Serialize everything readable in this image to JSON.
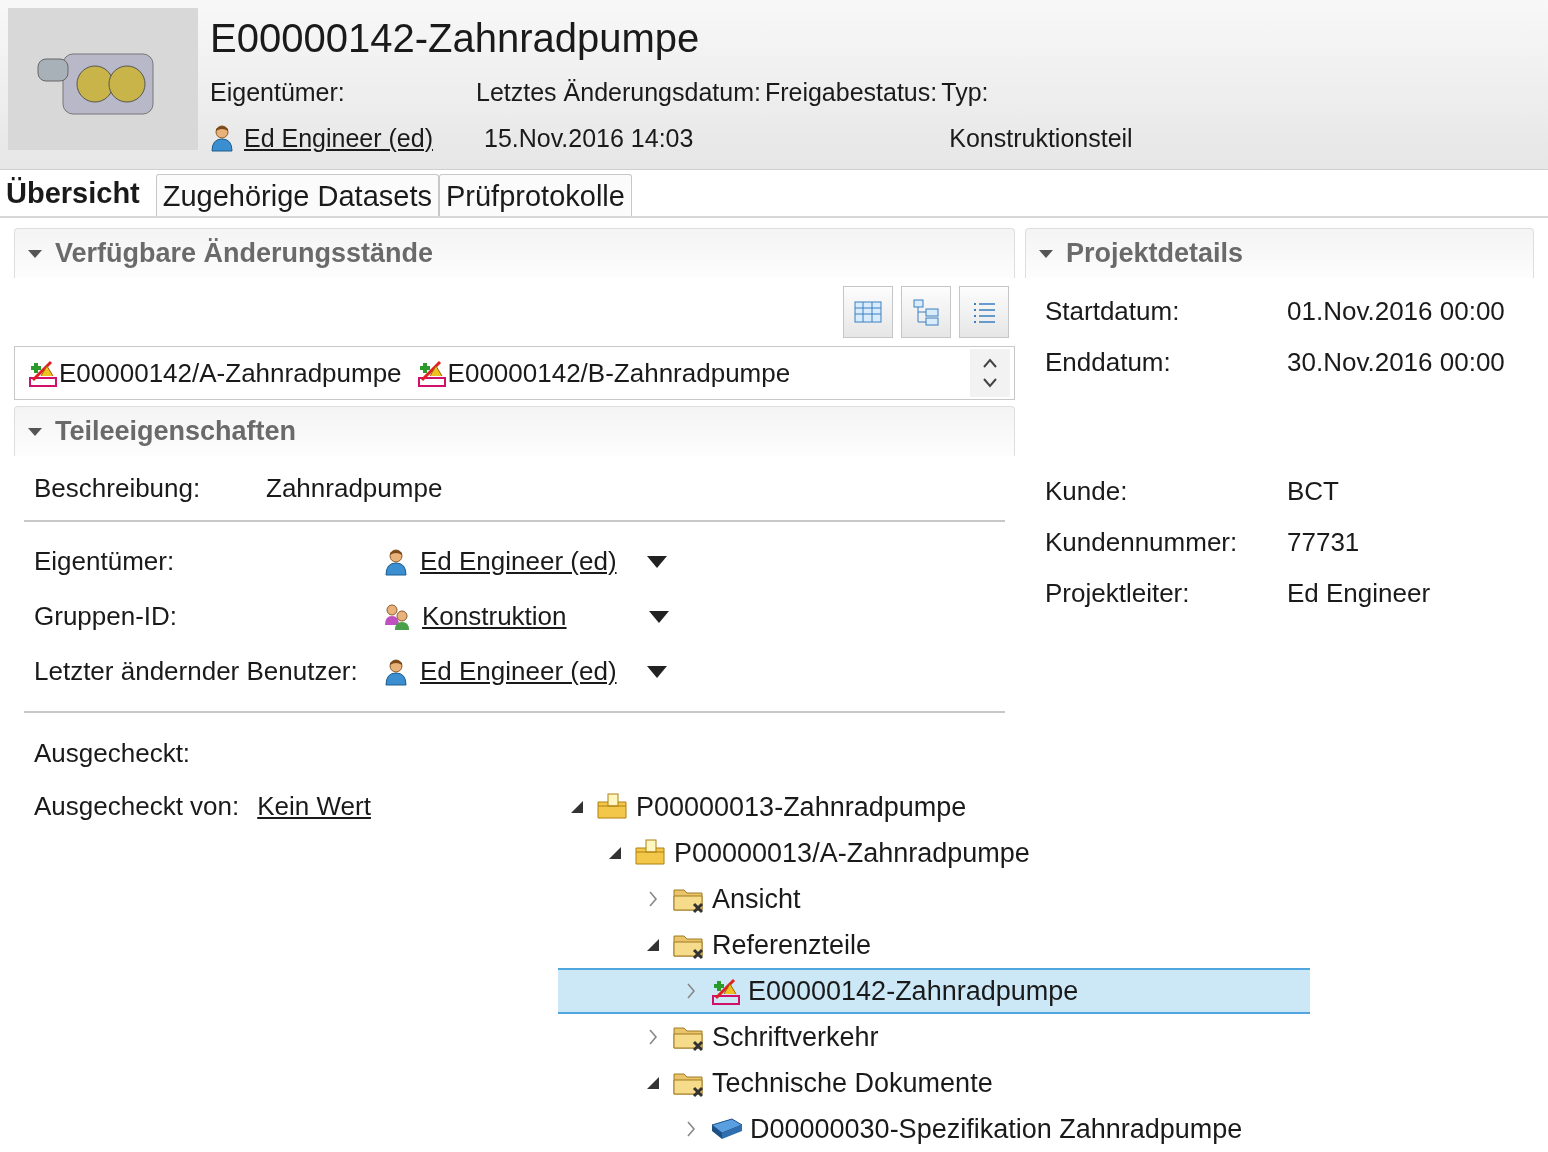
{
  "header": {
    "title": "E00000142-Zahnradpumpe",
    "fields": [
      {
        "label": "Eigentümer:",
        "value": "Ed Engineer (ed)",
        "kind": "user-link"
      },
      {
        "label": "Letztes Änderungsdatum:",
        "value": "15.Nov.2016 14:03",
        "kind": "text"
      },
      {
        "label": "Freigabestatus:"
      },
      {
        "label": "Typ:",
        "value": "Konstruktionsteil",
        "kind": "text"
      }
    ]
  },
  "tabs": [
    {
      "label": "Übersicht",
      "selected": true
    },
    {
      "label": "Zugehörige Datasets",
      "selected": false
    },
    {
      "label": "Prüfprotokolle",
      "selected": false
    }
  ],
  "revisions": {
    "title": "Verfügbare Änderungsstände",
    "expanded": true,
    "items": [
      "E00000142/A-Zahnradpumpe",
      "E00000142/B-Zahnradpumpe"
    ]
  },
  "part_properties": {
    "title": "Teileeigenschaften",
    "expanded": true,
    "description": {
      "label": "Beschreibung:",
      "value": "Zahnradpumpe"
    },
    "people": [
      {
        "label": "Eigentümer:",
        "value": "Ed Engineer (ed)",
        "kind": "user"
      },
      {
        "label": "Gruppen-ID:",
        "value": "Konstruktion",
        "kind": "group"
      },
      {
        "label": "Letzter ändernder Benutzer:",
        "value": "Ed Engineer (ed)",
        "kind": "user"
      }
    ],
    "checkout": [
      {
        "label": "Ausgecheckt:"
      },
      {
        "label": "Ausgecheckt von:",
        "value": "Kein Wert"
      }
    ]
  },
  "project_details": {
    "title": "Projektdetails",
    "expanded": true,
    "rows": [
      {
        "label": "Startdatum:",
        "value": "01.Nov.2016 00:00"
      },
      {
        "label": "Enddatum:",
        "value": "30.Nov.2016 00:00"
      }
    ],
    "customer_rows": [
      {
        "label": "Kunde:",
        "value": "BCT"
      },
      {
        "label": "Kundennummer:",
        "value": "77731"
      },
      {
        "label": "Projektleiter:",
        "value": "Ed Engineer"
      }
    ]
  },
  "tree": [
    {
      "label": "P00000013-Zahnradpumpe",
      "kind": "project",
      "expanded": true,
      "selected": false,
      "children": [
        {
          "label": "P00000013/A-Zahnradpumpe",
          "kind": "project",
          "expanded": true,
          "selected": false,
          "children": [
            {
              "label": "Ansicht",
              "kind": "folder",
              "expanded": false,
              "selected": false
            },
            {
              "label": "Referenzteile",
              "kind": "folder",
              "expanded": true,
              "selected": false,
              "children": [
                {
                  "label": "E00000142-Zahnradpumpe",
                  "kind": "part",
                  "expanded": false,
                  "selected": true
                }
              ]
            },
            {
              "label": "Schriftverkehr",
              "kind": "folder",
              "expanded": false,
              "selected": false
            },
            {
              "label": "Technische Dokumente",
              "kind": "folder",
              "expanded": true,
              "selected": false,
              "children": [
                {
                  "label": "D00000030-Spezifikation Zahnradpumpe",
                  "kind": "document",
                  "expanded": false,
                  "selected": false
                }
              ]
            }
          ]
        }
      ]
    }
  ]
}
